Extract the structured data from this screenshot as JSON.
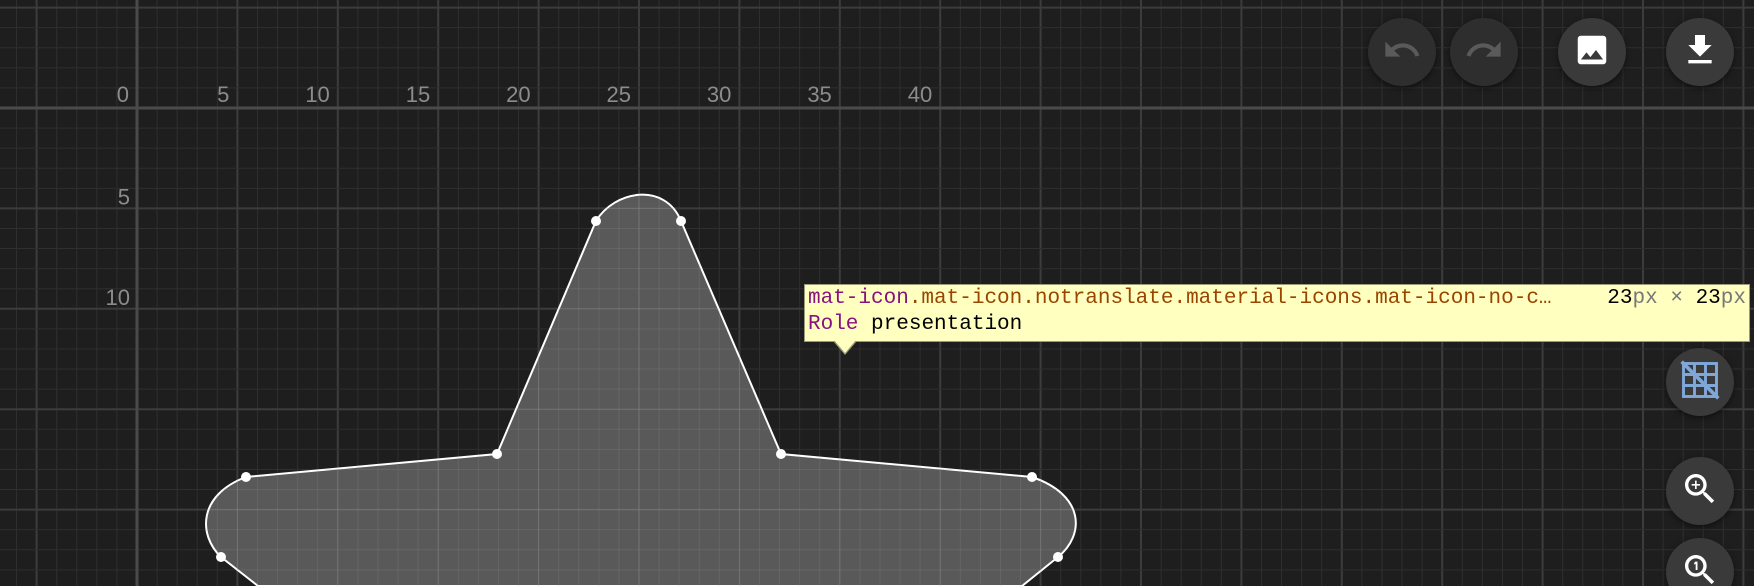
{
  "app": {
    "toolbar": {
      "undo_icon": "undo-icon",
      "redo_icon": "redo-icon",
      "image_icon": "image-icon",
      "download_icon": "download-icon"
    },
    "side_controls": {
      "grid_toggle_icon": "grid-off-icon",
      "zoom_in_icon": "zoom-in-icon",
      "zoom_reset_icon": "zoom-one-icon"
    },
    "colors": {
      "background": "#1e1e1e",
      "grid_minor": "#2f2f2f",
      "grid_major": "#3c3c3c",
      "shape_fill": "#5e5e5e",
      "shape_stroke": "#ffffff",
      "grid_toggle_active": "#7fa7d8"
    }
  },
  "rulers": {
    "x_labels": [
      "0",
      "5",
      "10",
      "15",
      "20",
      "25",
      "30",
      "35",
      "40"
    ],
    "y_labels": [
      "5",
      "10"
    ]
  },
  "tooltip": {
    "tag": "mat-icon",
    "classes": ".mat-icon.notranslate.material-icons.mat-icon-no-c…",
    "width": "23",
    "height": "23",
    "unit": "px",
    "times": "×",
    "role_key": "Role",
    "role_value": "presentation"
  }
}
